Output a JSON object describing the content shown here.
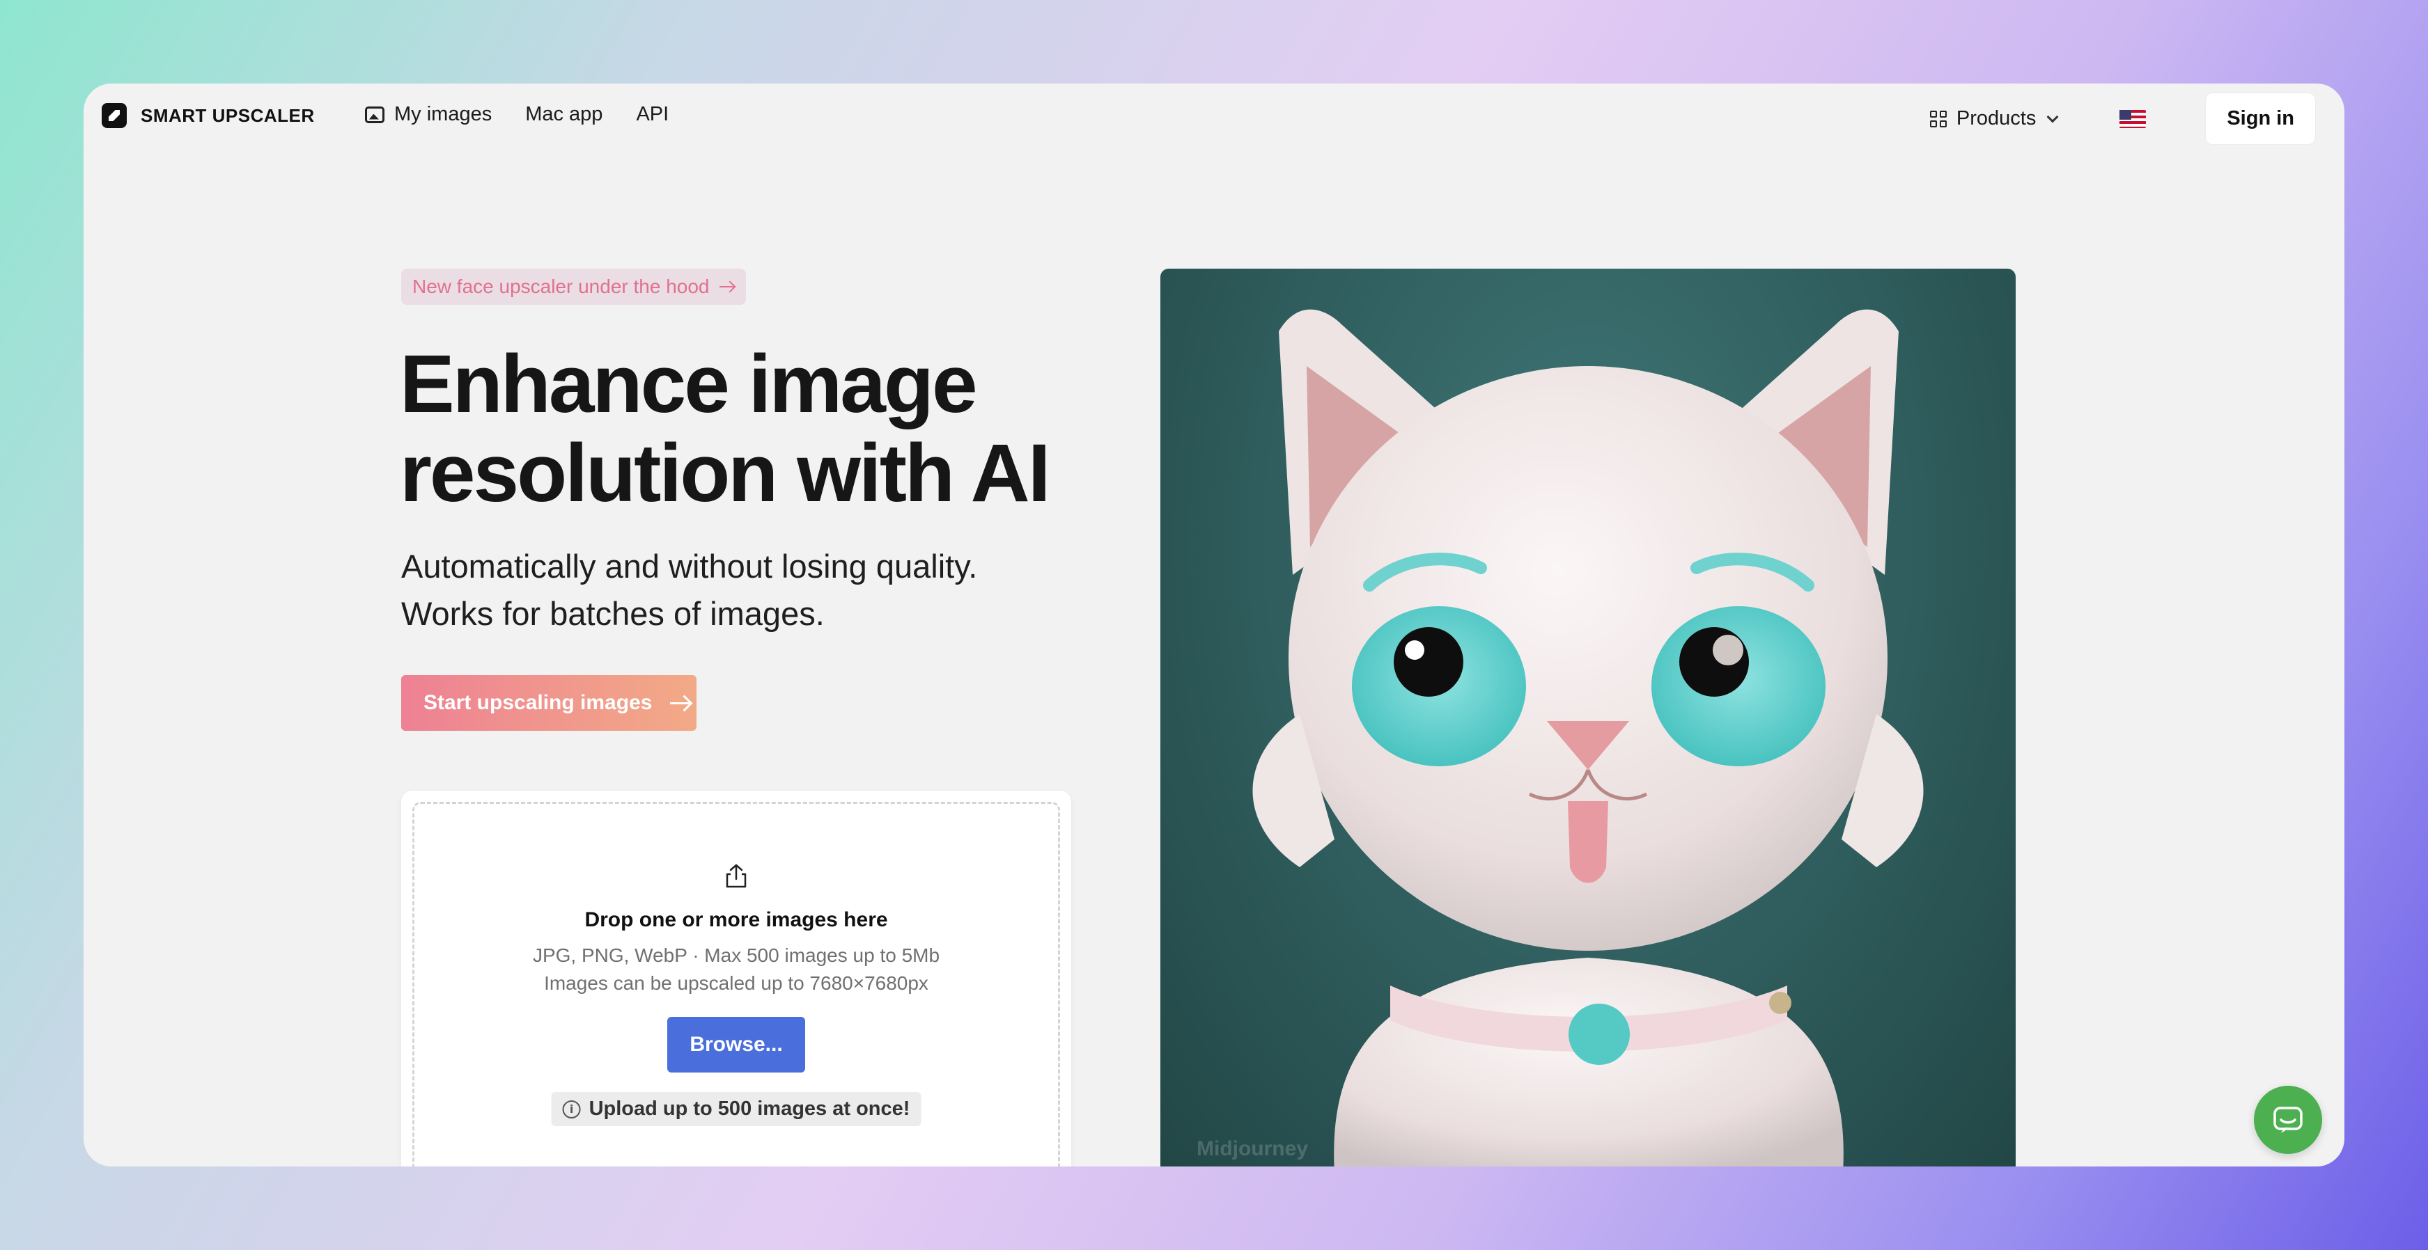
{
  "brand": {
    "name": "SMART UPSCALER"
  },
  "nav": {
    "links": [
      {
        "label": "My images",
        "icon": "images-icon"
      },
      {
        "label": "Mac app"
      },
      {
        "label": "API"
      }
    ],
    "products_label": "Products",
    "language": "en-US",
    "signin_label": "Sign in"
  },
  "hero": {
    "badge": "New face upscaler under the hood",
    "title_line1": "Enhance image",
    "title_line2": "resolution with AI",
    "subtitle_line1": "Automatically and without losing quality.",
    "subtitle_line2": "Works for batches of images.",
    "cta_label": "Start upscaling images"
  },
  "upload": {
    "title": "Drop one or more images here",
    "hint1": "JPG, PNG, WebP · Max 500 images up to 5Mb",
    "hint2": "Images can be upscaled up to 7680×7680px",
    "browse_label": "Browse...",
    "note": "Upload up to 500 images at once!"
  },
  "image": {
    "credit": "Midjourney"
  },
  "colors": {
    "accent": "#4a6fdc",
    "cta_start": "#ee8194",
    "cta_end": "#f2aa86",
    "badge_text": "#e0718f",
    "chat": "#4caf50"
  }
}
